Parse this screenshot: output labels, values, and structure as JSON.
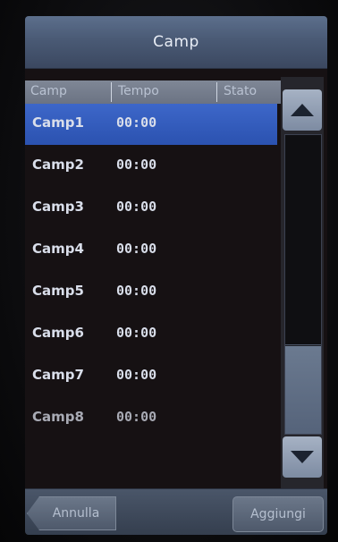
{
  "title": "Camp",
  "columns": [
    "Camp",
    "Tempo",
    "Stato"
  ],
  "rows": [
    {
      "name": "Camp1",
      "time": "00:00"
    },
    {
      "name": "Camp2",
      "time": "00:00"
    },
    {
      "name": "Camp3",
      "time": "00:00"
    },
    {
      "name": "Camp4",
      "time": "00:00"
    },
    {
      "name": "Camp5",
      "time": "00:00"
    },
    {
      "name": "Camp6",
      "time": "00:00"
    },
    {
      "name": "Camp7",
      "time": "00:00"
    },
    {
      "name": "Camp8",
      "time": "00:00"
    }
  ],
  "buttons": {
    "cancel": "Annulla",
    "add": "Aggiungi"
  },
  "icons": {
    "scroll_up": "triangle-up-icon",
    "scroll_down": "triangle-down-icon"
  },
  "colors": {
    "selection": "#2f58b8",
    "titlebar": "#4a5a75"
  }
}
